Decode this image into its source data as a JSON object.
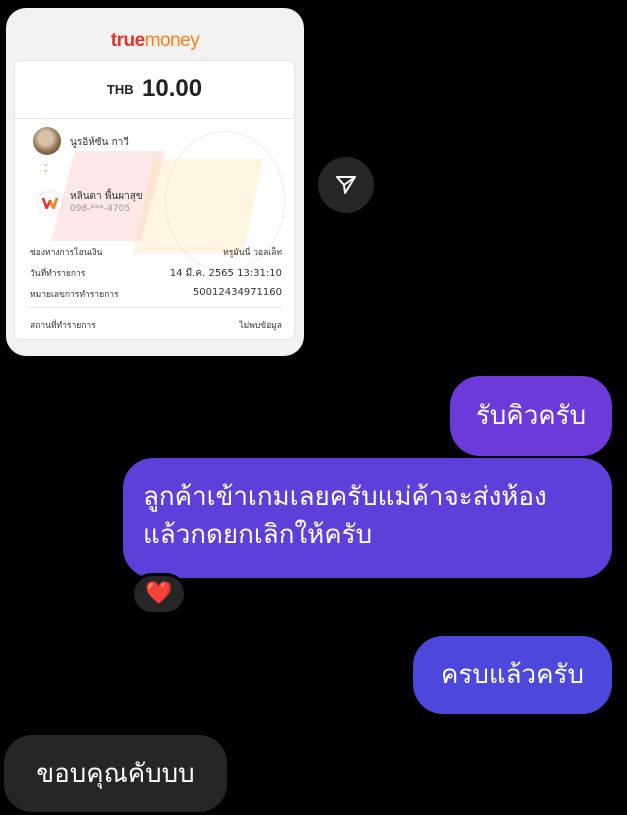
{
  "receipt": {
    "brand_part1": "true",
    "brand_part2": "money",
    "currency": "THB",
    "amount": "10.00",
    "sender_name": "นูรอิห์ซัน กาวี",
    "receiver_name": "หลินดา พื้นผาสุข",
    "receiver_phone": "098-***-4705",
    "rows": [
      {
        "label": "ช่องทางการโอนเงิน",
        "value": "ทรูมันนี่ วอลเล็ท"
      },
      {
        "label": "วันที่ทำรายการ",
        "value": "14 มี.ค. 2565 13:31:10"
      },
      {
        "label": "หมายเลขการทำรายการ",
        "value": "50012434971160"
      },
      {
        "label": "สถานที่ทำรายการ",
        "value": "ไม่พบข้อมูล"
      }
    ]
  },
  "icons": {
    "share": "send-icon",
    "reaction": "heart-icon"
  },
  "messages": [
    {
      "from": "me",
      "text": "รับคิวครับ"
    },
    {
      "from": "me",
      "text": "ลูกค้าเข้าเกมเลยครับแม่ค้าจะส่งห้องแล้วกดยกเลิกให้ครับ"
    },
    {
      "from": "me",
      "text": "ครบแล้วครับ"
    },
    {
      "from": "other",
      "text": "ขอบคุณคับบบ"
    }
  ],
  "reaction": "❤️",
  "colors": {
    "accent_red": "#e5322d",
    "accent_orange": "#f58220",
    "bubble_1": "#6c3ad8",
    "bubble_2": "#5f3fd9",
    "bubble_3": "#4e47dc",
    "bubble_other": "#262626"
  }
}
